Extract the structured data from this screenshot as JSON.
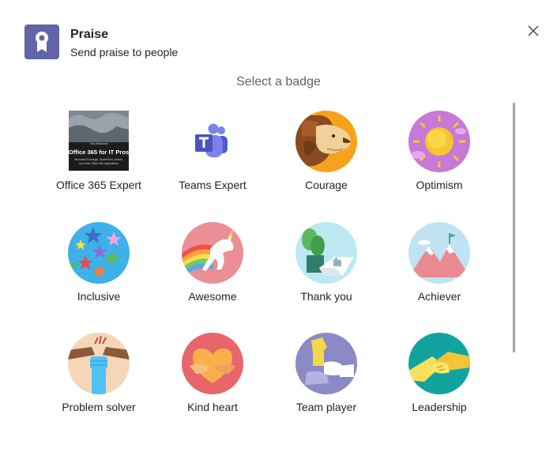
{
  "header": {
    "title": "Praise",
    "subtitle": "Send praise to people",
    "icon": "award-ribbon-icon",
    "accent_color": "#6264a7"
  },
  "close_icon": "close-icon",
  "select_label": "Select a badge",
  "book": {
    "title": "Office 365 for IT Pros",
    "author_line": "Tony Redmond",
    "tagline_1": "Microsoft Exchange, SharePoint, Teams,",
    "tagline_2": "and other Office 365 applications"
  },
  "badges": [
    {
      "label": "Office 365 Expert"
    },
    {
      "label": "Teams Expert"
    },
    {
      "label": "Courage"
    },
    {
      "label": "Optimism"
    },
    {
      "label": "Inclusive"
    },
    {
      "label": "Awesome"
    },
    {
      "label": "Thank you"
    },
    {
      "label": "Achiever"
    },
    {
      "label": "Problem solver"
    },
    {
      "label": "Kind heart"
    },
    {
      "label": "Team player"
    },
    {
      "label": "Leadership"
    }
  ]
}
